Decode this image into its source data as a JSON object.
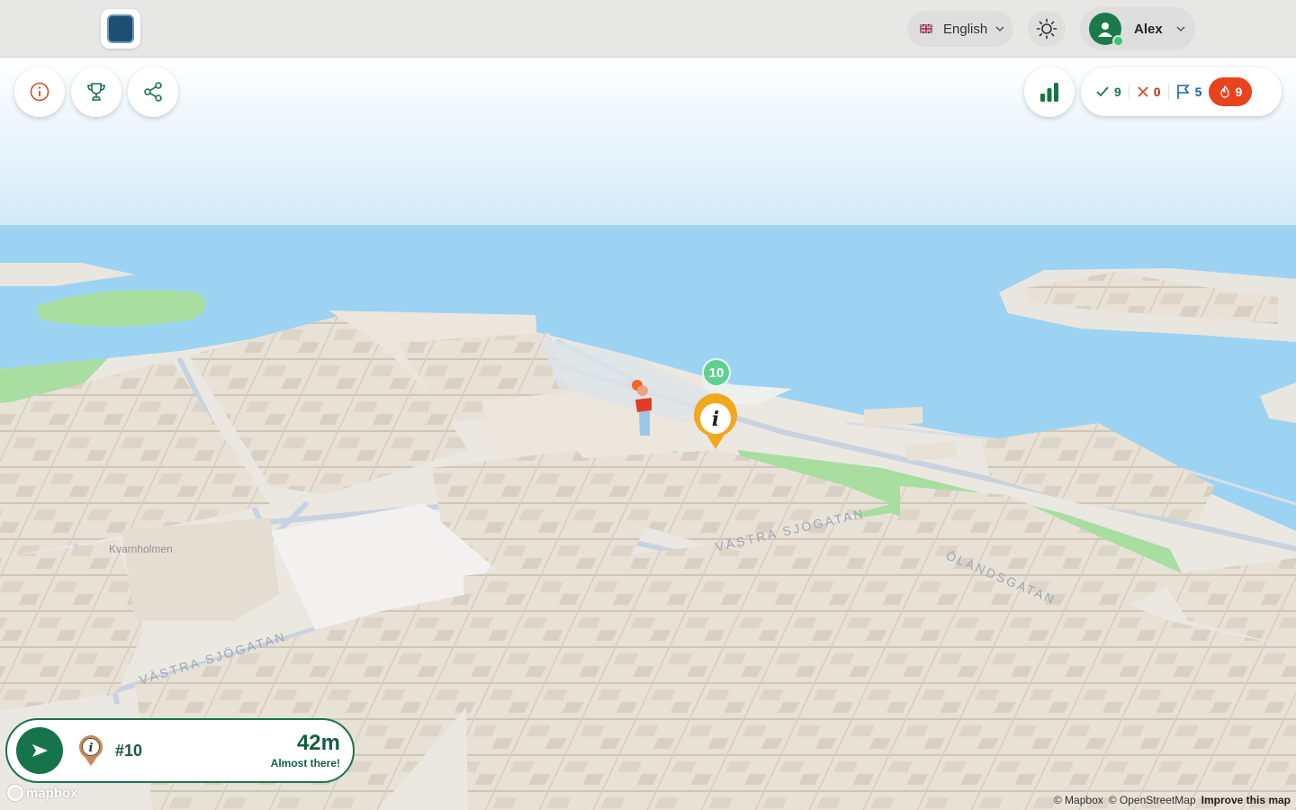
{
  "header": {
    "logo_icon": "coat-of-arms-logo",
    "language": {
      "label": "English",
      "flag": "uk-flag-icon"
    },
    "theme_icon": "sun-icon",
    "user": {
      "name": "Alex",
      "status": "online"
    }
  },
  "toolbar_left": [
    {
      "icon": "info-circle-icon"
    },
    {
      "icon": "trophy-icon"
    },
    {
      "icon": "share-icon"
    }
  ],
  "stats_button_icon": "bar-chart-icon",
  "score": {
    "correct": "9",
    "wrong": "0",
    "flags": "5",
    "streak": "9"
  },
  "navigation": {
    "target": "#10",
    "distance": "42m",
    "status": "Almost there!"
  },
  "map": {
    "street_labels": [
      "VÄSTRA SJÖGATAN",
      "VÄSTRA SJÖGATAN",
      "ÖLANDSGATAN"
    ],
    "poi_label": "Kvarnholmen",
    "marker_badge": "10",
    "marker_icon": "info-pin-icon"
  },
  "attribution": {
    "logo": "mapbox",
    "mapbox": "© Mapbox",
    "osm": "© OpenStreetMap",
    "improve": "Improve this map"
  },
  "colors": {
    "brand_green": "#17744a",
    "streak_orange": "#e8431c",
    "water": "#9dd3f2",
    "park": "#a8dea0",
    "building": "#e8e1d6",
    "marker_yellow": "#f2a81d",
    "badge_green": "#5fd08d"
  }
}
